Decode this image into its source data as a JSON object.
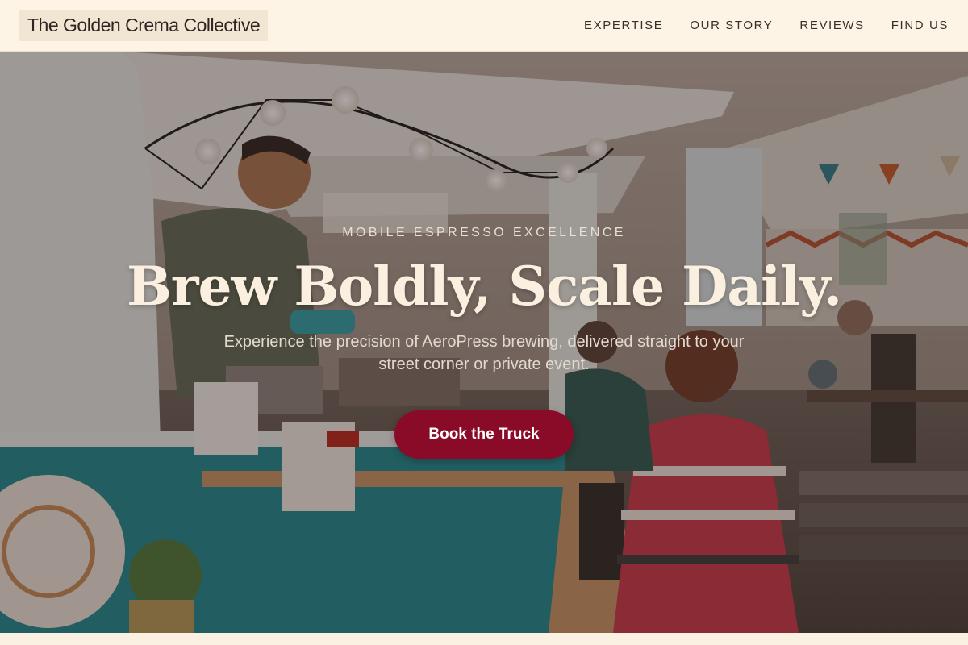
{
  "header": {
    "logo_text": "The Golden Crema Collective",
    "nav": [
      {
        "label": "EXPERTISE"
      },
      {
        "label": "OUR STORY"
      },
      {
        "label": "REVIEWS"
      },
      {
        "label": "FIND US"
      }
    ]
  },
  "hero": {
    "eyebrow": "MOBILE ESPRESSO EXCELLENCE",
    "headline": "Brew Boldly, Scale Daily.",
    "subtext": "Experience the precision of AeroPress brewing, delivered straight to your street corner or private event.",
    "cta_label": "Book the Truck"
  },
  "colors": {
    "header_bg": "#fdf4e6",
    "cta_bg": "#8a0b27",
    "headline": "#fbf0e0",
    "nav_text": "#3a2e2a"
  }
}
